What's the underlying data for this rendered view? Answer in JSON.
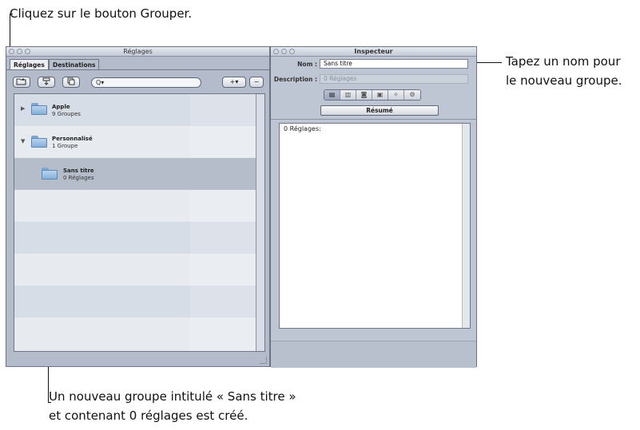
{
  "callouts": {
    "top": "Cliquez sur le bouton Grouper.",
    "right_line1": "Tapez un nom pour",
    "right_line2": "le nouveau groupe.",
    "bottom_line1": "Un nouveau groupe intitulé « Sans titre »",
    "bottom_line2": "et contenant 0 réglages est créé."
  },
  "settings_window": {
    "title": "Réglages",
    "tabs": [
      {
        "label": "Réglages",
        "active": true
      },
      {
        "label": "Destinations",
        "active": false
      }
    ],
    "toolbar": {
      "group_icon": "folder-group-icon",
      "icon2": "filter-icon",
      "icon3": "duplicate-icon",
      "search_placeholder": "Q▾",
      "add_label": "+▾",
      "remove_label": "−"
    },
    "items": [
      {
        "name": "Apple",
        "subtitle": "9 Groupes",
        "expanded": false
      },
      {
        "name": "Personnalisé",
        "subtitle": "1 Groupe",
        "expanded": true
      },
      {
        "name": "Sans titre",
        "subtitle": "0 Réglages",
        "selected": true
      }
    ]
  },
  "inspector_window": {
    "title": "Inspecteur",
    "name_label": "Nom :",
    "name_value": "Sans titre",
    "description_label": "Description :",
    "description_value": "0 Réglages",
    "segment_icons": [
      "summary-icon",
      "video-icon",
      "photo-icon",
      "layers-icon",
      "effects-icon",
      "gear-icon"
    ],
    "segment_button": "Résumé",
    "content_text": "0 Réglages:"
  }
}
